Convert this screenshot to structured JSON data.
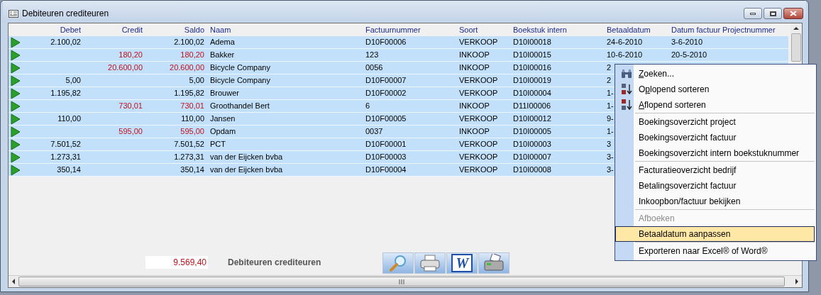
{
  "window": {
    "title": "Debiteuren crediteuren"
  },
  "table": {
    "columns": [
      "Debet",
      "Credit",
      "Saldo",
      "Naam",
      "Factuurnummer",
      "Soort",
      "Boekstuk intern",
      "Betaaldatum",
      "Datum factuur",
      "Projectnummer"
    ],
    "rows": [
      {
        "negative": false,
        "cells": [
          "2.100,02",
          "",
          "2.100,02",
          "Adema",
          "D10F00006",
          "VERKOOP",
          "D10I00018",
          "24-6-2010",
          "3-6-2010",
          ""
        ]
      },
      {
        "negative": true,
        "cells": [
          "",
          "180,20",
          "180,20",
          "Bakker",
          "123",
          "INKOOP",
          "D10I00015",
          "10-6-2010",
          "20-5-2010",
          ""
        ]
      },
      {
        "negative": true,
        "cells": [
          "",
          "20.600,00",
          "20.600,00",
          "Bicycle Company",
          "0056",
          "INKOOP",
          "D10I00016",
          "2",
          "",
          ""
        ]
      },
      {
        "negative": false,
        "cells": [
          "5,00",
          "",
          "5,00",
          "Bicycle Company",
          "D10F00007",
          "VERKOOP",
          "D10I00019",
          "2",
          "",
          ""
        ]
      },
      {
        "negative": false,
        "cells": [
          "1.195,82",
          "",
          "1.195,82",
          "Brouwer",
          "D10F00002",
          "VERKOOP",
          "D10I00004",
          "1-",
          "",
          ""
        ]
      },
      {
        "negative": true,
        "cells": [
          "",
          "730,01",
          "730,01",
          "Groothandel Bert",
          "6",
          "INKOOP",
          "D11I00006",
          "1-",
          "",
          ""
        ]
      },
      {
        "negative": false,
        "cells": [
          "110,00",
          "",
          "110,00",
          "Jansen",
          "D10F00005",
          "VERKOOP",
          "D10I00012",
          "9-",
          "",
          ""
        ]
      },
      {
        "negative": true,
        "cells": [
          "",
          "595,00",
          "595,00",
          "Opdam",
          "0037",
          "INKOOP",
          "D10I00005",
          "1-",
          "",
          ""
        ]
      },
      {
        "negative": false,
        "cells": [
          "7.501,52",
          "",
          "7.501,52",
          "PCT",
          "D10F00001",
          "VERKOOP",
          "D10I00003",
          "3",
          "",
          ""
        ]
      },
      {
        "negative": false,
        "cells": [
          "1.273,31",
          "",
          "1.273,31",
          "van der Eijcken bvba",
          "D10F00003",
          "VERKOOP",
          "D10I00007",
          "3-",
          "",
          ""
        ]
      },
      {
        "negative": false,
        "cells": [
          "350,14",
          "",
          "350,14",
          "van der Eijcken bvba",
          "D10F00004",
          "VERKOOP",
          "D10I00008",
          "3-",
          "",
          ""
        ]
      }
    ]
  },
  "footer": {
    "total": "9.569,40",
    "label": "Debiteuren crediteuren"
  },
  "toolbar": [
    {
      "kind": "search"
    },
    {
      "kind": "print"
    },
    {
      "kind": "word",
      "label": "W"
    },
    {
      "kind": "fax"
    }
  ],
  "context_menu": {
    "groups": [
      [
        {
          "key": "Z",
          "rest": "oeken...",
          "disabled": false,
          "selected": false
        },
        {
          "pre": "O",
          "key": "p",
          "rest": "lopend sorteren",
          "disabled": false,
          "selected": false
        },
        {
          "key": "A",
          "rest": "flopend sorteren",
          "disabled": false,
          "selected": false
        }
      ],
      [
        {
          "rest": "Boekingsoverzicht project",
          "disabled": false,
          "selected": false
        },
        {
          "rest": "Boekingsoverzicht factuur",
          "disabled": false,
          "selected": false
        },
        {
          "rest": "Boekingsoverzicht intern boekstuknummer",
          "disabled": false,
          "selected": false
        }
      ],
      [
        {
          "rest": "Facturatieoverzicht bedrijf",
          "disabled": false,
          "selected": false
        },
        {
          "rest": "Betalingsoverzicht factuur",
          "disabled": false,
          "selected": false
        },
        {
          "rest": "Inkoopbon/factuur bekijken",
          "disabled": false,
          "selected": false
        }
      ],
      [
        {
          "rest": "Afboeken",
          "disabled": true,
          "selected": false
        },
        {
          "rest": "Betaaldatum aanpassen",
          "disabled": false,
          "selected": true
        }
      ],
      [
        {
          "rest": "Exporteren naar Excel® of Word®",
          "disabled": false,
          "selected": false
        }
      ]
    ]
  }
}
